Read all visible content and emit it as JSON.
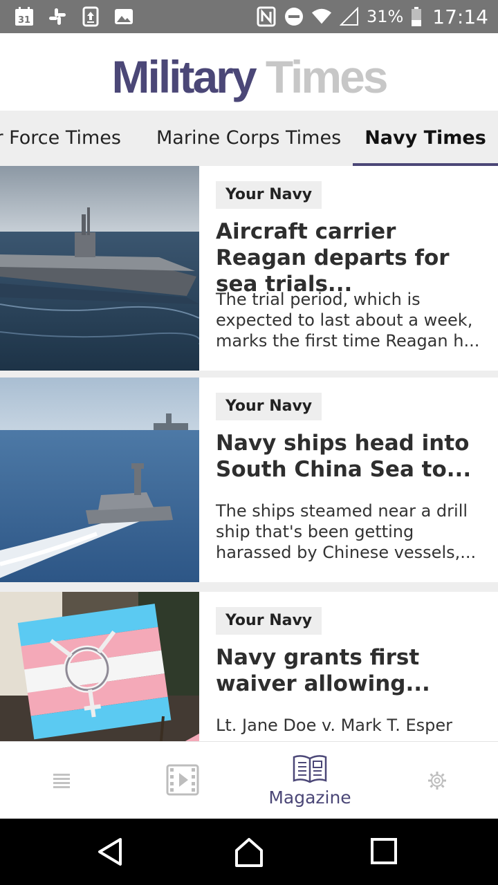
{
  "status_bar": {
    "calendar_day": "31",
    "battery_percent": "31%",
    "time": "17:14",
    "icons": [
      "calendar-icon",
      "slack-icon",
      "upload-icon",
      "image-icon",
      "nfc-icon",
      "do-not-disturb-icon",
      "wifi-icon",
      "signal-icon",
      "battery-icon"
    ]
  },
  "header": {
    "logo_part1": "Military",
    "logo_part2": "Times"
  },
  "tabs": [
    {
      "label": "ir Force Times",
      "selected": false
    },
    {
      "label": "Marine Corps Times",
      "selected": false
    },
    {
      "label": "Navy Times",
      "selected": true
    }
  ],
  "articles": [
    {
      "category": "Your Navy",
      "title": "Aircraft carrier Reagan departs for sea trials...",
      "description": "The trial period, which is expected to last about a week, marks the first time Reagan h...",
      "image": "aircraft-carrier-photo"
    },
    {
      "category": "Your Navy",
      "title": "Navy ships head into South China Sea to...",
      "description": "The ships steamed near a drill ship that's been getting harassed by Chinese vessels,...",
      "image": "littoral-combat-ship-photo"
    },
    {
      "category": "Your Navy",
      "title": "Navy grants first waiver allowing...",
      "description": "Lt. Jane Doe v. Mark T. Esper",
      "image": "transgender-flag-photo"
    }
  ],
  "bottom_nav": [
    {
      "icon": "list-icon",
      "label": ""
    },
    {
      "icon": "video-icon",
      "label": ""
    },
    {
      "icon": "magazine-icon",
      "label": "Magazine",
      "selected": true
    },
    {
      "icon": "settings-icon",
      "label": ""
    }
  ],
  "colors": {
    "brand": "#4b4777",
    "logo_secondary": "#c7c7c7",
    "status_bar": "#757575",
    "tab_bar": "#eeeeee"
  }
}
